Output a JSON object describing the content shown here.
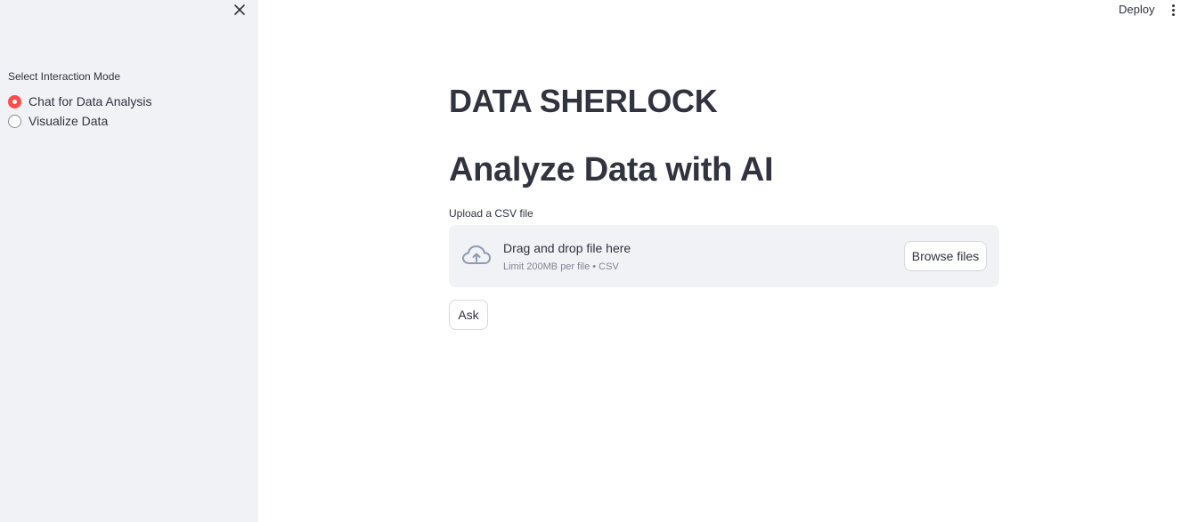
{
  "sidebar": {
    "close_icon": "close-icon",
    "radio_group": {
      "label": "Select Interaction Mode",
      "options": [
        {
          "label": "Chat for Data Analysis",
          "selected": true
        },
        {
          "label": "Visualize Data",
          "selected": false
        }
      ]
    }
  },
  "header": {
    "deploy_label": "Deploy",
    "menu_icon": "more-vertical-icon"
  },
  "main": {
    "title": "DATA SHERLOCK",
    "subtitle": "Analyze Data with AI",
    "uploader": {
      "label": "Upload a CSV file",
      "icon": "cloud-upload-icon",
      "drop_text": "Drag and drop file here",
      "limit_text": "Limit 200MB per file • CSV",
      "browse_label": "Browse files"
    },
    "ask_label": "Ask"
  },
  "colors": {
    "accent": "#ff4b4b",
    "sidebar_bg": "#f0f2f6",
    "text": "#31333f",
    "muted_text": "#808495",
    "icon": "#8e9bb3"
  }
}
